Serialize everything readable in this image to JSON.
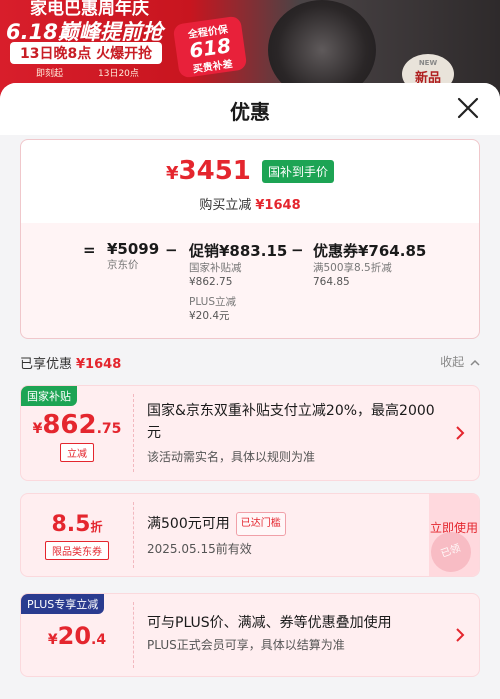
{
  "promo": {
    "line1": "家电巴惠周年庆",
    "line2": "6.18巅峰提前抢",
    "line3": "13日晚8点 火爆开抢",
    "line4": "即刻起",
    "line5": "13日20点",
    "badge_top": "全程价保",
    "badge_mid": "618",
    "badge_bottom": "买贵补差",
    "new_top": "NEW",
    "new_label": "新品"
  },
  "sheet": {
    "title": "优惠"
  },
  "summary": {
    "currency": "¥",
    "price": "3451",
    "price_tag": "国补到手价",
    "instant_label": "购买立减",
    "instant_amount": "¥1648",
    "eq": "=",
    "jd_price": "¥5099",
    "jd_price_label": "京东价",
    "minus1": "−",
    "promo_value": "促销¥883.15",
    "promo_sub1": "国家补贴减",
    "promo_sub1_val": "¥862.75",
    "promo_sub2": "PLUS立减",
    "promo_sub2_val": "¥20.4元",
    "minus2": "−",
    "coupon_value": "优惠券¥764.85",
    "coupon_sub1": "满500享8.5折减",
    "coupon_sub1_val": "764.85"
  },
  "enjoyed": {
    "label": "已享优惠",
    "amount": "¥1648",
    "collapse": "收起"
  },
  "cards": [
    {
      "corner": "国家补贴",
      "corner_color": "#1da454",
      "cur": "¥",
      "int": "862",
      "dec": ".75",
      "tag": "立减",
      "line1": "国家&京东双重补贴支付立减20%，最高2000元",
      "line2": "该活动需实名，具体以规则为准"
    },
    {
      "int": "8.5",
      "dec": "折",
      "tag": "限品类东券",
      "line1": "满500元可用",
      "used_tag": "已达门槛",
      "line2": "2025.05.15前有效",
      "button": "立即使用",
      "stamp": "已领"
    },
    {
      "corner": "PLUS专享立减",
      "corner_color": "#2a3b8f",
      "cur": "¥",
      "int": "20",
      "dec": ".4",
      "line1": "可与PLUS价、满减、券等优惠叠加使用",
      "line2": "PLUS正式会员可享，具体以结算为准"
    }
  ],
  "icons": {
    "close": "close-icon",
    "chevron_right": "chevron-right-icon",
    "chevron_up": "chevron-up-icon"
  },
  "colors": {
    "accent_red": "#e4262e",
    "green": "#1da454",
    "plus_blue": "#2a3b8f"
  }
}
